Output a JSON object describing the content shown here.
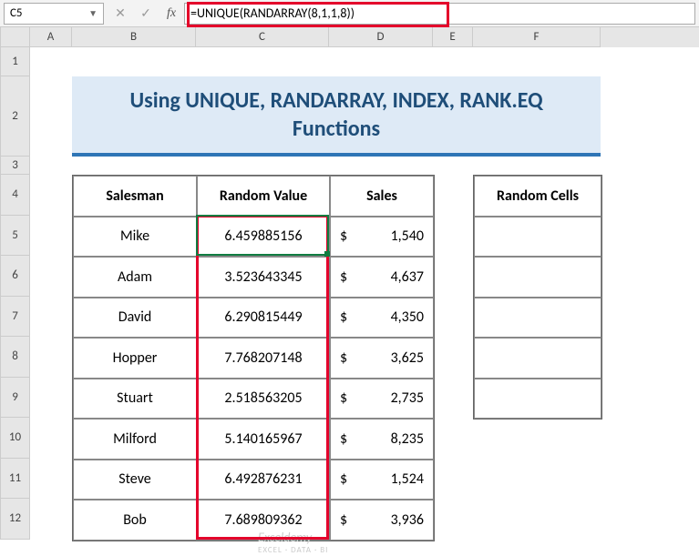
{
  "formula_bar": {
    "cell_ref": "C5",
    "formula": "=UNIQUE(RANDARRAY(8,1,1,8))"
  },
  "columns": [
    "A",
    "B",
    "C",
    "D",
    "E",
    "F"
  ],
  "rows": [
    "1",
    "2",
    "3",
    "4",
    "5",
    "6",
    "7",
    "8",
    "9",
    "10",
    "11",
    "12"
  ],
  "title": "Using UNIQUE, RANDARRAY, INDEX, RANK.EQ Functions",
  "headers": {
    "salesman": "Salesman",
    "random": "Random Value",
    "sales": "Sales",
    "random_cells": "Random Cells"
  },
  "table": [
    {
      "salesman": "Mike",
      "random": "6.459885156",
      "sales": "1,540"
    },
    {
      "salesman": "Adam",
      "random": "3.523643345",
      "sales": "4,637"
    },
    {
      "salesman": "David",
      "random": "6.290815449",
      "sales": "4,350"
    },
    {
      "salesman": "Hopper",
      "random": "7.768207148",
      "sales": "3,625"
    },
    {
      "salesman": "Stuart",
      "random": "2.518563205",
      "sales": "2,735"
    },
    {
      "salesman": "Milford",
      "random": "5.140165967",
      "sales": "8,235"
    },
    {
      "salesman": "Steve",
      "random": "6.492876231",
      "sales": "1,524"
    },
    {
      "salesman": "Bob",
      "random": "7.689809362",
      "sales": "3,936"
    }
  ],
  "currency": "$",
  "watermark": {
    "main": "Exceldemy",
    "sub": "EXCEL · DATA · BI"
  }
}
